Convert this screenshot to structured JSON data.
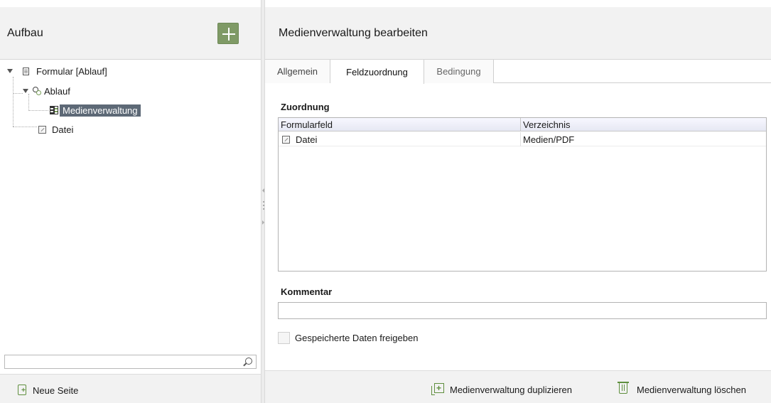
{
  "left_panel": {
    "title": "Aufbau",
    "add_button": "add",
    "tree": {
      "root": "Formular [Ablauf]",
      "child_flow": "Ablauf",
      "child_media": "Medienverwaltung",
      "child_file": "Datei"
    },
    "search": {
      "value": "",
      "placeholder": ""
    },
    "footer": {
      "new_page_label": "Neue Seite"
    }
  },
  "right_panel": {
    "title": "Medienverwaltung bearbeiten",
    "tabs": [
      {
        "label": "Allgemein"
      },
      {
        "label": "Feldzuordnung"
      },
      {
        "label": "Bedingung"
      }
    ],
    "active_tab": "Feldzuordnung",
    "mapping": {
      "section_title": "Zuordnung",
      "columns": [
        "Formularfeld",
        "Verzeichnis"
      ],
      "rows": [
        {
          "field": "Datei",
          "directory": "Medien/PDF"
        }
      ]
    },
    "comment": {
      "section_title": "Kommentar",
      "value": ""
    },
    "release_checkbox": {
      "label": "Gespeicherte Daten freigeben",
      "checked": false
    },
    "footer": {
      "duplicate_label": "Medienverwaltung duplizieren",
      "delete_label": "Medienverwaltung löschen"
    }
  },
  "colors": {
    "accent_green": "#7f9a66",
    "selection": "#5d6976",
    "header_bg": "#f2f2f2"
  }
}
